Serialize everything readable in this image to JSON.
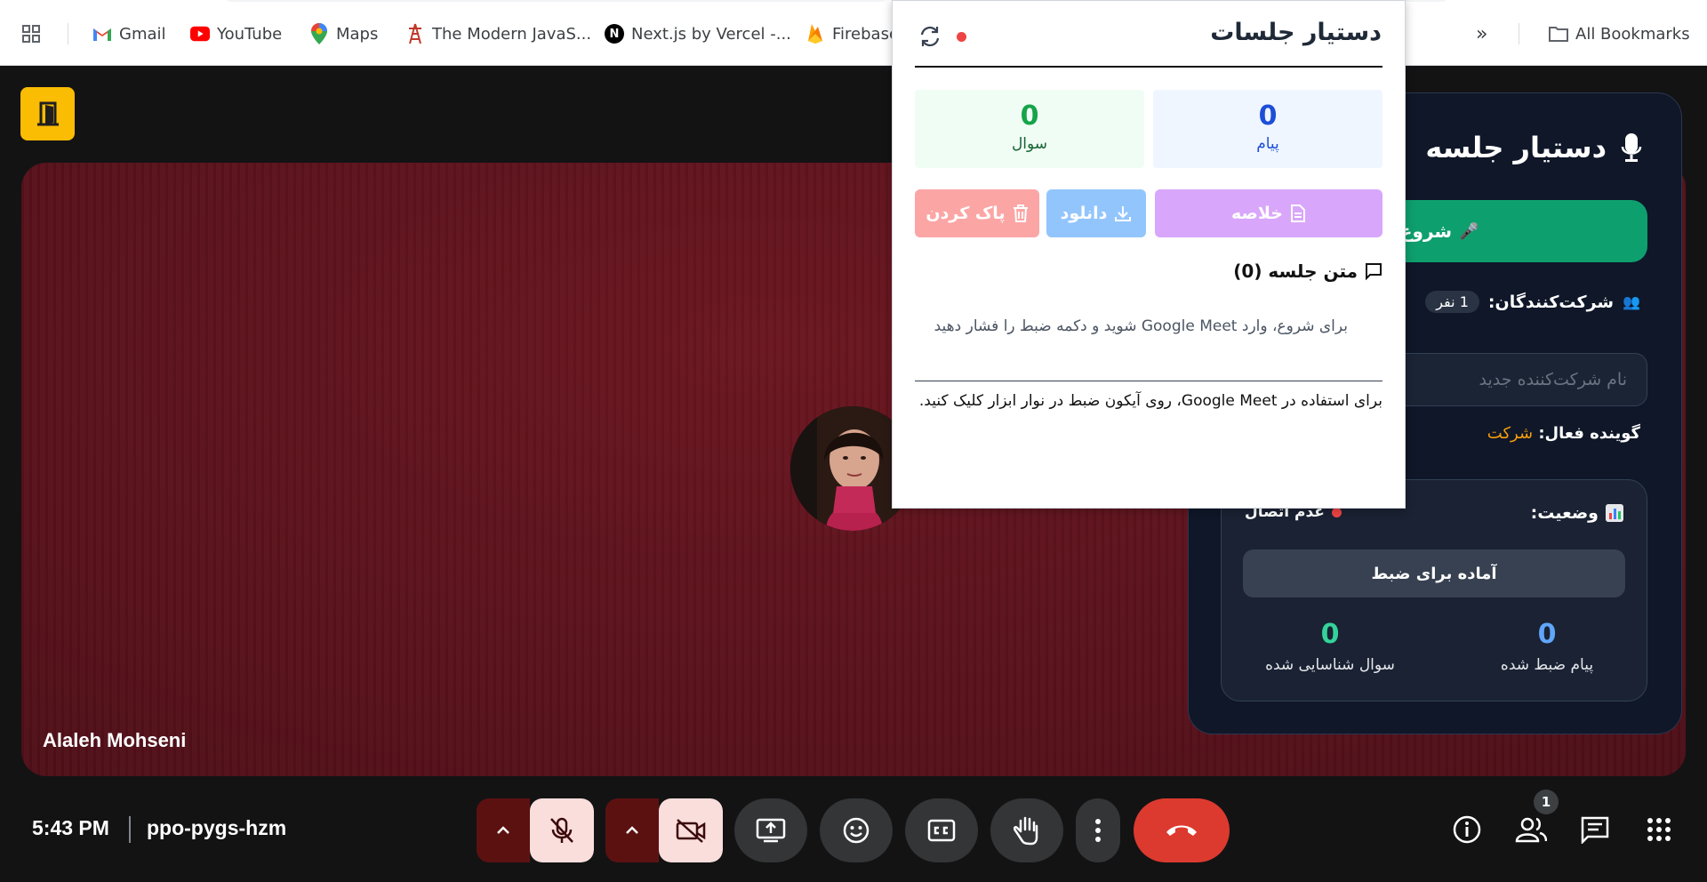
{
  "bookmarks": {
    "items": [
      {
        "label": "Gmail",
        "icon": "gmail-icon"
      },
      {
        "label": "YouTube",
        "icon": "youtube-icon"
      },
      {
        "label": "Maps",
        "icon": "maps-icon"
      },
      {
        "label": "The Modern JavaS...",
        "icon": "js-tower-icon"
      },
      {
        "label": "Next.js by Vercel -...",
        "icon": "nextjs-icon"
      },
      {
        "label": "Firebase",
        "icon": "firebase-icon"
      }
    ],
    "overflow": "»",
    "all_bookmarks": "All Bookmarks"
  },
  "meeting": {
    "participant_name": "Alaleh Mohseni",
    "time": "5:43 PM",
    "code": "ppo-pygs-hzm",
    "participants_badge": "1"
  },
  "side_panel": {
    "title": "دستیار جلسه",
    "record_button": "شروع ضبط",
    "participants_label": "شرکت‌کنندگان:",
    "participants_count": "1 نفر",
    "name_placeholder": "نام شرکت‌کننده جدید",
    "active_speaker_label": "گوینده فعال:",
    "active_speaker_value": "شرکت",
    "status_label": "وضعیت:",
    "status_value": "عدم اتصال",
    "ready_text": "آماده برای ضبط",
    "recorded_messages": {
      "value": "0",
      "label": "پیام ضبط شده"
    },
    "detected_questions": {
      "value": "0",
      "label": "سوال شناسایی شده"
    }
  },
  "popup": {
    "title": "دستیار جلسات",
    "messages": {
      "value": "0",
      "label": "پیام"
    },
    "questions": {
      "value": "0",
      "label": "سوال"
    },
    "summary_button": "خلاصه",
    "download_button": "دانلود",
    "clear_button": "پاک کردن",
    "transcript_heading": "متن جلسه (0)",
    "empty_hint": "برای شروع، وارد Google Meet شوید و دکمه ضبط را فشار دهید",
    "footer_note": "برای استفاده در Google Meet، روی آیکون ضبط در نوار ابزار کلیک کنید."
  },
  "colors": {
    "exit": "#fbbc04",
    "end_call": "#dc3a2f",
    "record": "#0e9f6e",
    "summary": "#d8a6fb",
    "download": "#93c5fd",
    "clear": "#fca5a5",
    "messages_bg": "#eff6ff",
    "questions_bg": "#f0fdf4"
  }
}
